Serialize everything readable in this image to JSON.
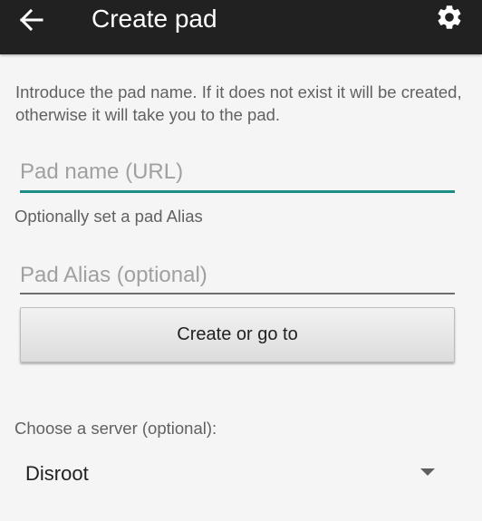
{
  "app_bar": {
    "title": "Create pad",
    "back_icon": "arrow-left-icon",
    "settings_icon": "gear-icon",
    "background_color": "#212121"
  },
  "form": {
    "intro_text": "Introduce the pad name. If it does not exist it will be created, otherwise it will take you to the pad.",
    "pad_name": {
      "value": "",
      "placeholder": "Pad name (URL)"
    },
    "alias_hint": "Optionally set a pad Alias",
    "pad_alias": {
      "value": "",
      "placeholder": "Pad Alias (optional)"
    },
    "create_button_label": "Create or go to",
    "accent_color": "#1b8f86"
  },
  "server": {
    "label": "Choose a server (optional):",
    "selected": "Disroot"
  }
}
